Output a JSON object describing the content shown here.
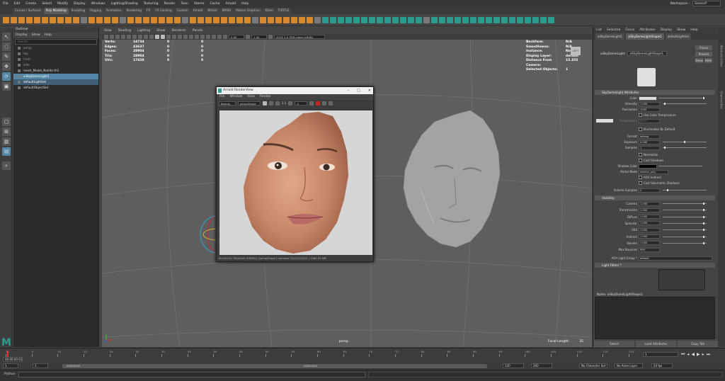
{
  "menubar": {
    "items": [
      "File",
      "Edit",
      "Create",
      "Select",
      "Modify",
      "Display",
      "Windows",
      "Lighting/Shading",
      "Texturing",
      "Render",
      "Toon",
      "Stereo",
      "Cache",
      "Arnold",
      "Help"
    ],
    "workspace_label": "Workspace :",
    "workspace_value": "General*"
  },
  "shelf_tabs": [
    "Curves / Surfaces",
    "Poly Modeling",
    "Sculpting",
    "Rigging",
    "Animation",
    "Rendering",
    "FX",
    "FX Caching",
    "Custom",
    "Arnold",
    "Bifrost",
    "MASH",
    "Motion Graphics",
    "XGen",
    "TURTLE"
  ],
  "shelf_active": "Poly Modeling",
  "outliner": {
    "title": "Outliner",
    "menu": [
      "Display",
      "Show",
      "Help"
    ],
    "search_placeholder": "Search...",
    "items": [
      {
        "label": "persp",
        "style": "dim"
      },
      {
        "label": "top",
        "style": "dim"
      },
      {
        "label": "front",
        "style": "dim"
      },
      {
        "label": "side",
        "style": "dim"
      },
      {
        "label": "mesh_Model_Nobite.th1",
        "style": "bright"
      },
      {
        "label": "aiSkyDomeLight1",
        "style": "sel"
      },
      {
        "label": "defaultLightSet",
        "style": "sel2"
      },
      {
        "label": "defaultObjectSet",
        "style": "bright"
      }
    ]
  },
  "viewport": {
    "menu": [
      "View",
      "Shading",
      "Lighting",
      "Show",
      "Renderer",
      "Panels"
    ],
    "gamma_value": "0.00",
    "exposure_value": "1.00",
    "colorspace": "ACES 1.0 SDR-video (sRGB)",
    "hud_left": [
      {
        "k": "Verts:",
        "v": [
          "14734",
          "0",
          "0"
        ]
      },
      {
        "k": "Edges:",
        "v": [
          "43637",
          "0",
          "0"
        ]
      },
      {
        "k": "Faces:",
        "v": [
          "28904",
          "0",
          "0"
        ]
      },
      {
        "k": "Tris:",
        "v": [
          "28904",
          "0",
          "0"
        ]
      },
      {
        "k": "UVs:",
        "v": [
          "17658",
          "0",
          "0"
        ]
      }
    ],
    "hud_right": [
      {
        "k": "Backface:",
        "v": "N/A"
      },
      {
        "k": "Smoothness:",
        "v": "N/A"
      },
      {
        "k": "Instance:",
        "v": "No"
      },
      {
        "k": "Display Layer:",
        "v": "default"
      },
      {
        "k": "Distance From Camera:",
        "v": "15.355"
      },
      {
        "k": "Selected Objects:",
        "v": "1"
      }
    ],
    "camera_label": "persp",
    "cube_label": "LEFT",
    "focal_label": "Focal Length:",
    "focal_value": "35"
  },
  "render_view": {
    "title": "Arnold RenderView",
    "menu": [
      "File",
      "Window",
      "View",
      "Render"
    ],
    "beauty": "Beauty",
    "camera": "perspShape",
    "zoom": "1:1",
    "exposure": "0",
    "status": "00:00:00 | 994x549 (28282) | perspShape | samples 3/2/2/2/2/2/2 | 1984.49 MB"
  },
  "attribute_editor": {
    "menu": [
      "List",
      "Selected",
      "Focus",
      "Attributes",
      "Display",
      "Show",
      "Help"
    ],
    "tabs": [
      "aiSkyDomeLight1",
      "aiSkyDomeLightShape1",
      "defaultLightSet"
    ],
    "node_label": "aiSkyDomeLight:",
    "node_value": "aiSkyDomeLightShape1",
    "focus_btn": "Focus",
    "presets_btn": "Presets",
    "show_btn": "Show",
    "hide_btn": "Hide",
    "section_main": "SkyDomeLight Attributes",
    "color_label": "Color",
    "intensity_label": "Intensity",
    "intensity_value": "1.000",
    "resolution_label": "Resolution",
    "resolution_value": "1000",
    "use_color_temp": "Use Color Temperature",
    "temperature_label": "Temperature",
    "temperature_value": "6500",
    "illuminates": "Illuminates By Default",
    "format_label": "Format",
    "format_value": "latlong",
    "exposure_label": "Exposure",
    "exposure_value": "0.000",
    "samples_label": "Samples",
    "samples_value": "1",
    "normalize": "Normalize",
    "cast_shadows": "Cast Shadows",
    "shadow_color_label": "Shadow Color",
    "portal_label": "Portal Mode",
    "portal_value": "interior_only",
    "aov_indirect": "AOV Indirect",
    "cast_vol_shadows": "Cast Volumetric Shadows",
    "volume_samples_label": "Volume Samples",
    "volume_samples_value": "2",
    "section_visibility": "Visibility",
    "vis": [
      {
        "l": "Camera",
        "v": "1.000"
      },
      {
        "l": "Transmission",
        "v": "1.000"
      },
      {
        "l": "Diffuse",
        "v": "1.000"
      },
      {
        "l": "Specular",
        "v": "1.000"
      },
      {
        "l": "SSS",
        "v": "1.000"
      },
      {
        "l": "Indirect",
        "v": "1.000"
      },
      {
        "l": "Volume",
        "v": "1.000"
      }
    ],
    "max_bounces_label": "Max Bounces",
    "max_bounces_value": "999",
    "aov_group_label": "AOV Light Group *",
    "aov_group_value": "default",
    "section_filters": "Light Filters *",
    "notes_label": "Notes: aiSkyDomeLightShape1",
    "bottom": [
      "Select",
      "Load Attributes",
      "Copy Tab"
    ]
  },
  "right_side": [
    "Attribute Editor",
    "Channel Box"
  ],
  "timeline": {
    "ticks": [
      "1",
      "5",
      "10",
      "15",
      "20",
      "25",
      "30",
      "35",
      "40",
      "45",
      "50",
      "55",
      "60",
      "65",
      "70",
      "75",
      "80",
      "85",
      "90",
      "95",
      "100",
      "105",
      "110",
      "115",
      "120"
    ],
    "current_frame": "1",
    "time_display": "00:00:00:01"
  },
  "range": {
    "start": "1",
    "start2": "1",
    "end_inner": "120",
    "end_outer": "200",
    "range_label": "00000000",
    "range_end": "00000000",
    "character_set": "No Character Set",
    "anim_layer": "No Anim Layer",
    "fps": "24 fps"
  },
  "command": {
    "lang": "Python"
  }
}
